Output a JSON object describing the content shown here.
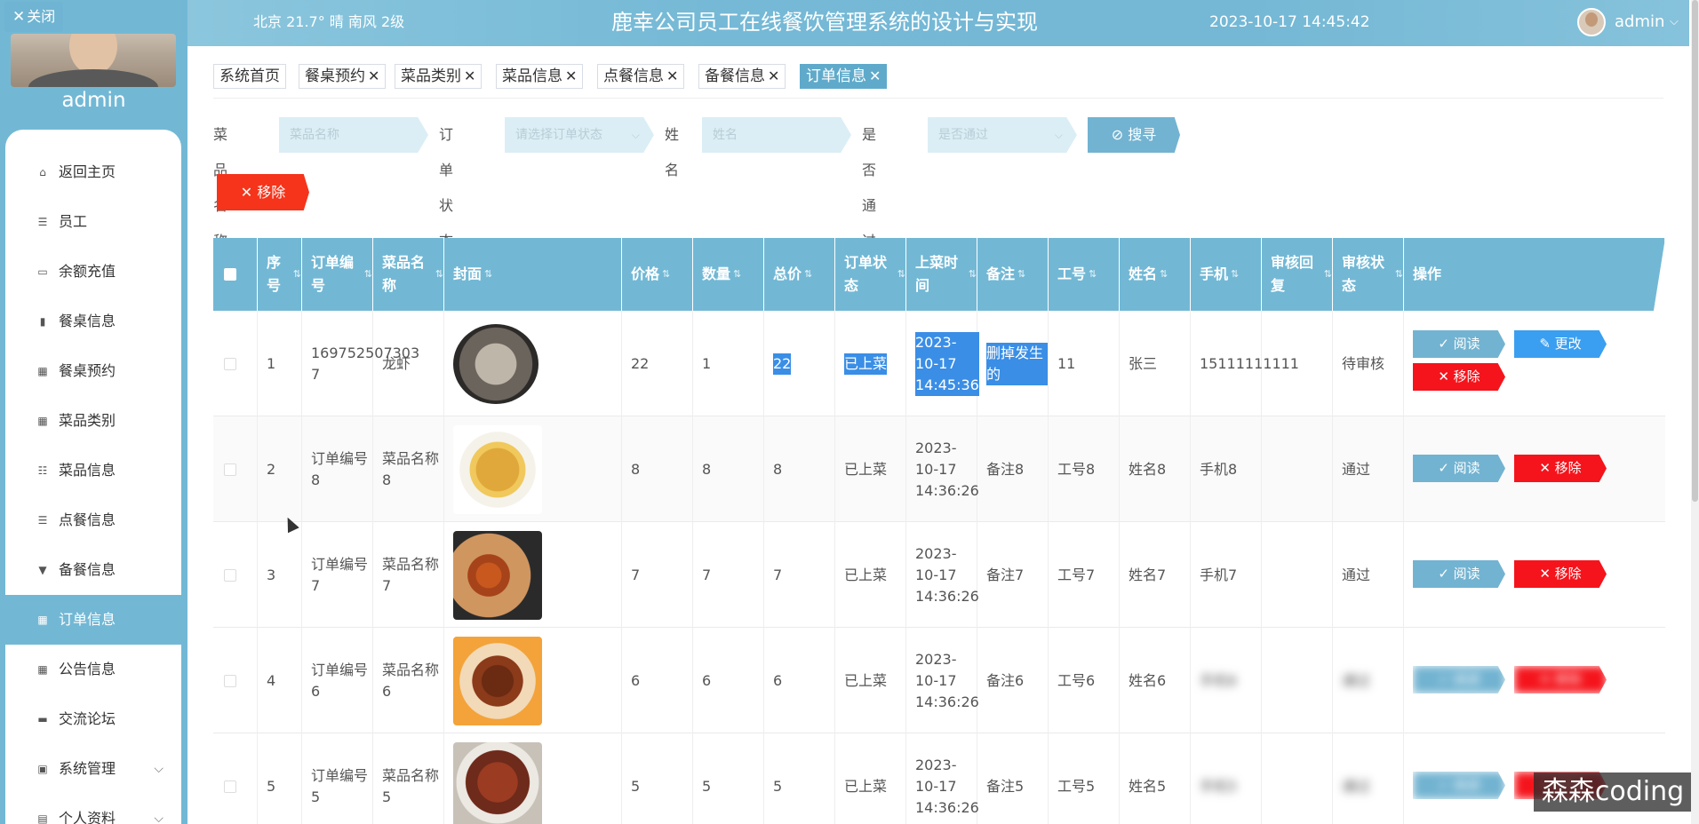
{
  "header": {
    "weather": "北京  21.7°  晴  南风  2级",
    "title": "鹿幸公司员工在线餐饮管理系统的设计与实现",
    "datetime": "2023-10-17 14:45:42",
    "user": "admin"
  },
  "sidebar": {
    "close_label": "关闭",
    "username": "admin",
    "items": [
      {
        "label": "返回主页",
        "icon": "home-icon"
      },
      {
        "label": "员工",
        "icon": "list-icon"
      },
      {
        "label": "余额充值",
        "icon": "wallet-icon"
      },
      {
        "label": "餐桌信息",
        "icon": "chart-icon"
      },
      {
        "label": "餐桌预约",
        "icon": "grid-icon"
      },
      {
        "label": "菜品类别",
        "icon": "grid-icon"
      },
      {
        "label": "菜品信息",
        "icon": "sliders-icon"
      },
      {
        "label": "点餐信息",
        "icon": "list-icon"
      },
      {
        "label": "备餐信息",
        "icon": "cup-icon"
      },
      {
        "label": "订单信息",
        "icon": "grid-icon",
        "active": true
      },
      {
        "label": "公告信息",
        "icon": "grid-icon"
      },
      {
        "label": "交流论坛",
        "icon": "chat-icon"
      },
      {
        "label": "系统管理",
        "icon": "clipboard-icon",
        "expandable": true
      },
      {
        "label": "个人资料",
        "icon": "card-icon",
        "expandable": true
      }
    ]
  },
  "tabs": [
    "系统首页",
    "餐桌预约",
    "菜品类别",
    "菜品信息",
    "点餐信息",
    "备餐信息",
    "订单信息"
  ],
  "search": {
    "dish_label": "菜品名称",
    "dish_placeholder": "菜品名称",
    "status_label": "订单状态",
    "status_placeholder": "请选择订单状态",
    "name_label": "姓名",
    "name_placeholder": "姓名",
    "pass_label": "是否通过",
    "pass_placeholder": "是否通过",
    "search_button": "搜寻"
  },
  "toolbar": {
    "remove_button": "移除"
  },
  "table": {
    "headers": [
      "序号",
      "订单编号",
      "菜品名称",
      "封面",
      "价格",
      "数量",
      "总价",
      "订单状态",
      "上菜时间",
      "备注",
      "工号",
      "姓名",
      "手机",
      "审核回复",
      "审核状态",
      "操作"
    ],
    "rows": [
      {
        "idx": "1",
        "order_no": "169752507303 7",
        "dish": "龙虾",
        "price": "22",
        "qty": "1",
        "total": "22",
        "status": "已上菜",
        "time": "2023-10-17 14:45:36",
        "note": "删掉发生的",
        "emp_no": "11",
        "name": "张三",
        "phone": "15111111111",
        "reply": "",
        "audit": "待审核",
        "food": "shrimp-image"
      },
      {
        "idx": "2",
        "order_no": "订单编号8",
        "dish": "菜品名称8",
        "price": "8",
        "qty": "8",
        "total": "8",
        "status": "已上菜",
        "time": "2023-10-17 14:36:26",
        "note": "备注8",
        "emp_no": "工号8",
        "name": "姓名8",
        "phone": "手机8",
        "reply": "",
        "audit": "通过",
        "food": "rice-dish-image"
      },
      {
        "idx": "3",
        "order_no": "订单编号7",
        "dish": "菜品名称7",
        "price": "7",
        "qty": "7",
        "total": "7",
        "status": "已上菜",
        "time": "2023-10-17 14:36:26",
        "note": "备注7",
        "emp_no": "工号7",
        "name": "姓名7",
        "phone": "手机7",
        "reply": "",
        "audit": "通过",
        "food": "wings-image"
      },
      {
        "idx": "4",
        "order_no": "订单编号6",
        "dish": "菜品名称6",
        "price": "6",
        "qty": "6",
        "total": "6",
        "status": "已上菜",
        "time": "2023-10-17 14:36:26",
        "note": "备注6",
        "emp_no": "工号6",
        "name": "姓名6",
        "phone": "手机6",
        "reply": "",
        "audit": "通过",
        "food": "braised-meat-image"
      },
      {
        "idx": "5",
        "order_no": "订单编号5",
        "dish": "菜品名称5",
        "price": "5",
        "qty": "5",
        "total": "5",
        "status": "已上菜",
        "time": "2023-10-17 14:36:26",
        "note": "备注5",
        "emp_no": "工号5",
        "name": "姓名5",
        "phone": "手机5",
        "reply": "",
        "audit": "通过",
        "food": "stew-image"
      }
    ],
    "actions": {
      "read": "阅读",
      "edit": "更改",
      "remove": "移除"
    }
  },
  "watermark": "森森coding"
}
